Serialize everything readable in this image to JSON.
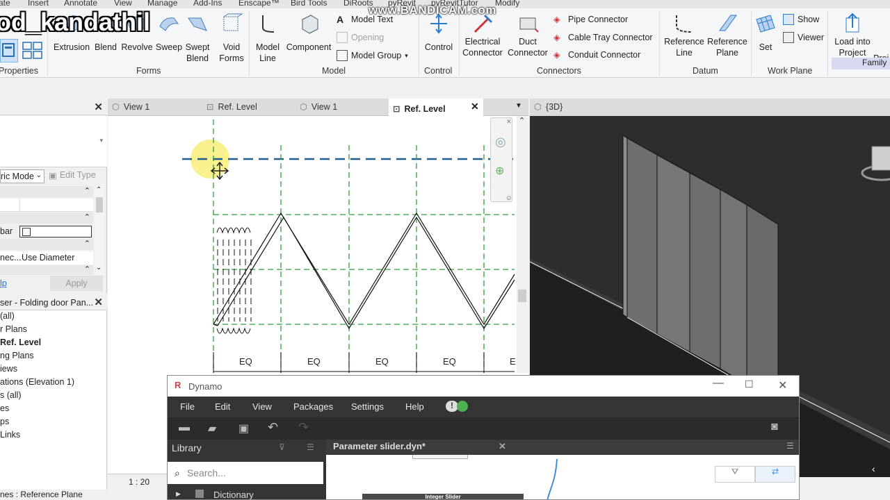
{
  "watermark": "www.BANDICAM.com",
  "overlay_username": "od_kandathil",
  "ribbon_tabs": [
    "ate",
    "Insert",
    "Annotate",
    "View",
    "Manage",
    "Add-Ins",
    "Enscape™",
    "Bird Tools",
    "DiRoots",
    "pyRevit",
    "pyRevitTutor",
    "Modify"
  ],
  "ribbon": {
    "forms": [
      "Extrusion",
      "Blend",
      "Revolve",
      "Sweep",
      "Swept Blend",
      "Void Forms"
    ],
    "forms_label": "Forms",
    "properties_label": "Properties",
    "model": {
      "model_line": "Model Line",
      "component": "Component",
      "model_text": "Model Text",
      "opening": "Opening",
      "model_group": "Model Group",
      "label": "Model"
    },
    "control": {
      "button": "Control",
      "label": "Control"
    },
    "connectors": {
      "electrical": "Electrical Connector",
      "duct": "Duct Connector",
      "pipe": "Pipe Connector",
      "cable_tray": "Cable Tray Connector",
      "conduit": "Conduit Connector",
      "label": "Connectors"
    },
    "datum": {
      "ref_line": "Reference Line",
      "ref_plane": "Reference Plane",
      "label": "Datum"
    },
    "work_plane": {
      "set": "Set",
      "show": "Show",
      "viewer": "Viewer",
      "label": "Work Plane"
    },
    "family": {
      "load": "Load into Project",
      "proj": "Proj",
      "label": "Family"
    }
  },
  "properties_panel": {
    "type_selector": "ric Mode",
    "edit_type": "Edit Type",
    "row_bar": "bar",
    "row_diameter_label": "nec...",
    "row_diameter_value": "Use Diameter",
    "help": "lp",
    "apply": "Apply"
  },
  "project_browser": {
    "title": "ser - Folding door Pan...",
    "items": [
      "(all)",
      "r Plans",
      "Ref. Level",
      "ng Plans",
      "iews",
      "ations (Elevation 1)",
      "s (all)",
      "es",
      "ps",
      "Links"
    ],
    "bold_index": 2
  },
  "view_tabs": [
    {
      "label": "View 1",
      "active": false
    },
    {
      "label": "Ref. Level",
      "active": false
    },
    {
      "label": "View 1",
      "active": false
    },
    {
      "label": "Ref. Level",
      "active": true
    }
  ],
  "view_3d_tab": "{3D}",
  "plan": {
    "dimension_labels": [
      "EQ",
      "EQ",
      "EQ",
      "EQ",
      "E"
    ],
    "scale": "1 : 20"
  },
  "status_text": "nes : Reference Plane",
  "dynamo": {
    "title": "Dynamo",
    "menu": [
      "File",
      "Edit",
      "View",
      "Packages",
      "Settings",
      "Help"
    ],
    "library_label": "Library",
    "search_placeholder": "Search...",
    "dictionary": "Dictionary",
    "file_tab": "Parameter slider.dyn*",
    "node_title": "Integer Slider"
  },
  "colors": {
    "ref_plane_green": "#2e9e3a",
    "ref_level_blue": "#1f5d8c",
    "highlight_yellow": "#f7ef7a",
    "family_panel": "#d7daf0"
  }
}
